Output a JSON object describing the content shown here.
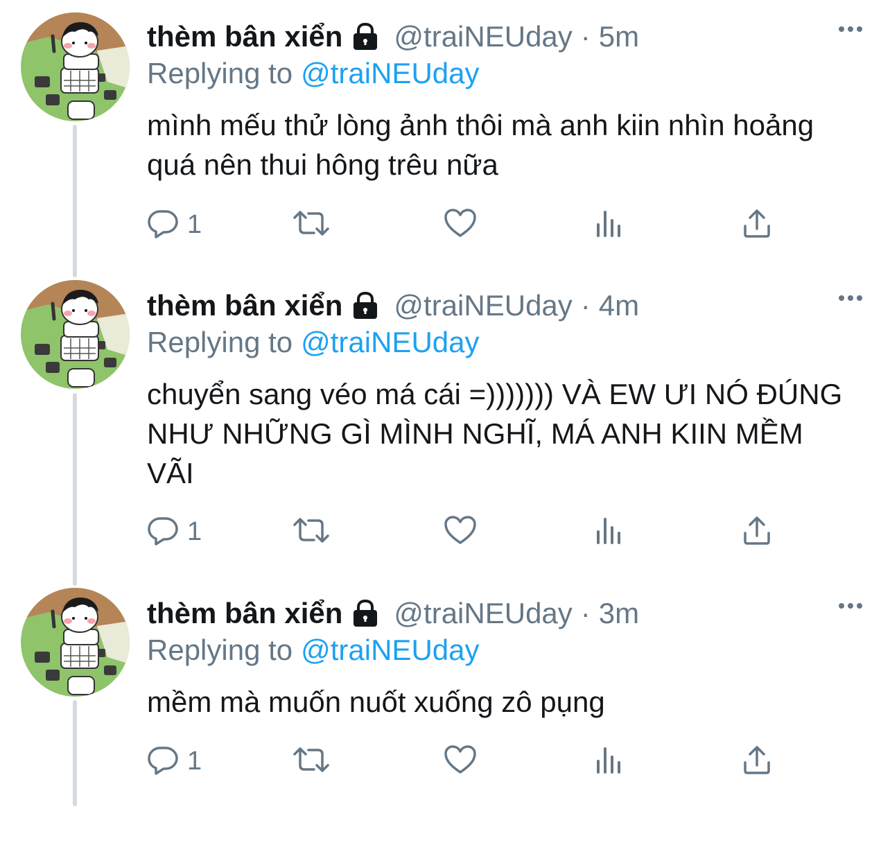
{
  "tweets": [
    {
      "name": "thèm bân xiển",
      "handle": "@traiNEUday",
      "separator": "·",
      "time": "5m",
      "replying_label": "Replying to",
      "replying_handle": "@traiNEUday",
      "text": "mình mếu thử lòng ảnh thôi mà anh kiin nhìn hoảng quá nên thui hông trêu nữa",
      "reply_count": "1",
      "icons": [
        "reply-icon",
        "retweet-icon",
        "like-icon",
        "analytics-icon",
        "share-icon"
      ]
    },
    {
      "name": "thèm bân xiển",
      "handle": "@traiNEUday",
      "separator": "·",
      "time": "4m",
      "replying_label": "Replying to",
      "replying_handle": "@traiNEUday",
      "text": "chuyển sang véo má cái =))))))) VÀ EW ƯI NÓ ĐÚNG NHƯ NHỮNG GÌ MÌNH NGHĨ, MÁ ANH KIIN MỀM VÃI",
      "reply_count": "1",
      "icons": [
        "reply-icon",
        "retweet-icon",
        "like-icon",
        "analytics-icon",
        "share-icon"
      ]
    },
    {
      "name": "thèm bân xiển",
      "handle": "@traiNEUday",
      "separator": "·",
      "time": "3m",
      "replying_label": "Replying to",
      "replying_handle": "@traiNEUday",
      "text": "mềm mà muốn nuốt xuống zô pụng",
      "reply_count": "1",
      "icons": [
        "reply-icon",
        "retweet-icon",
        "like-icon",
        "analytics-icon",
        "share-icon"
      ]
    }
  ],
  "colors": {
    "text": "#14171a",
    "secondary": "#657786",
    "link": "#1da1f2",
    "thread_line": "#d4d9de"
  }
}
